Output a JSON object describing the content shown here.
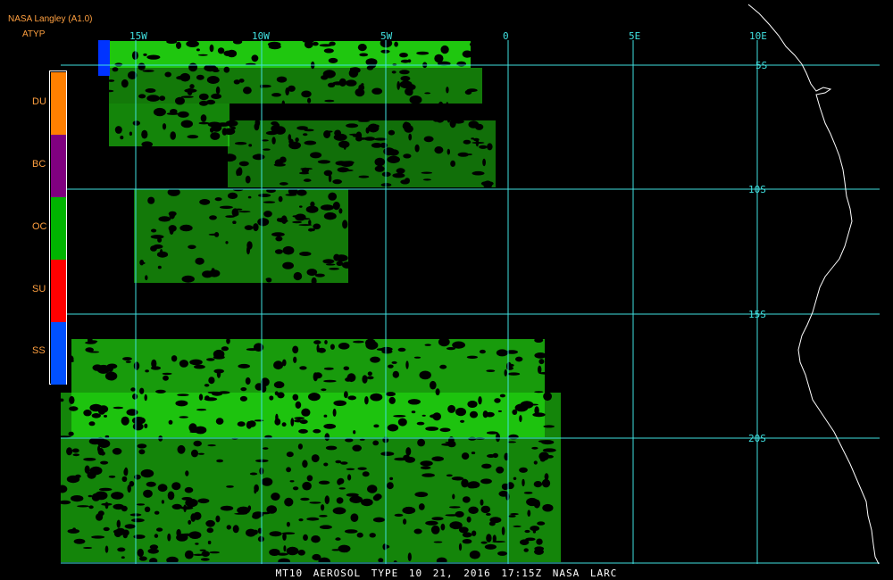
{
  "header": {
    "organization": "NASA Langley (A1.0)",
    "product": "ATYP"
  },
  "legend": {
    "items": [
      {
        "code": "DU",
        "color": "#ff8000"
      },
      {
        "code": "BC",
        "color": "#800080"
      },
      {
        "code": "OC",
        "color": "#00b400"
      },
      {
        "code": "SU",
        "color": "#ff0000"
      },
      {
        "code": "SS",
        "color": "#0050ff"
      }
    ]
  },
  "grid": {
    "longitude_labels": [
      "15W",
      "10W",
      "5W",
      "0",
      "5E",
      "10E"
    ],
    "latitude_labels": [
      "5S",
      "10S",
      "15S",
      "20S"
    ],
    "line_color": "#40e0e0"
  },
  "caption": "MT10  AEROSOL TYPE  10 21, 2016 17:15Z  NASA LARC",
  "colors": {
    "background": "#000000",
    "aerosol_fill": "#22dd11",
    "coastline": "#ffffff",
    "label_text": "#ffa040"
  }
}
